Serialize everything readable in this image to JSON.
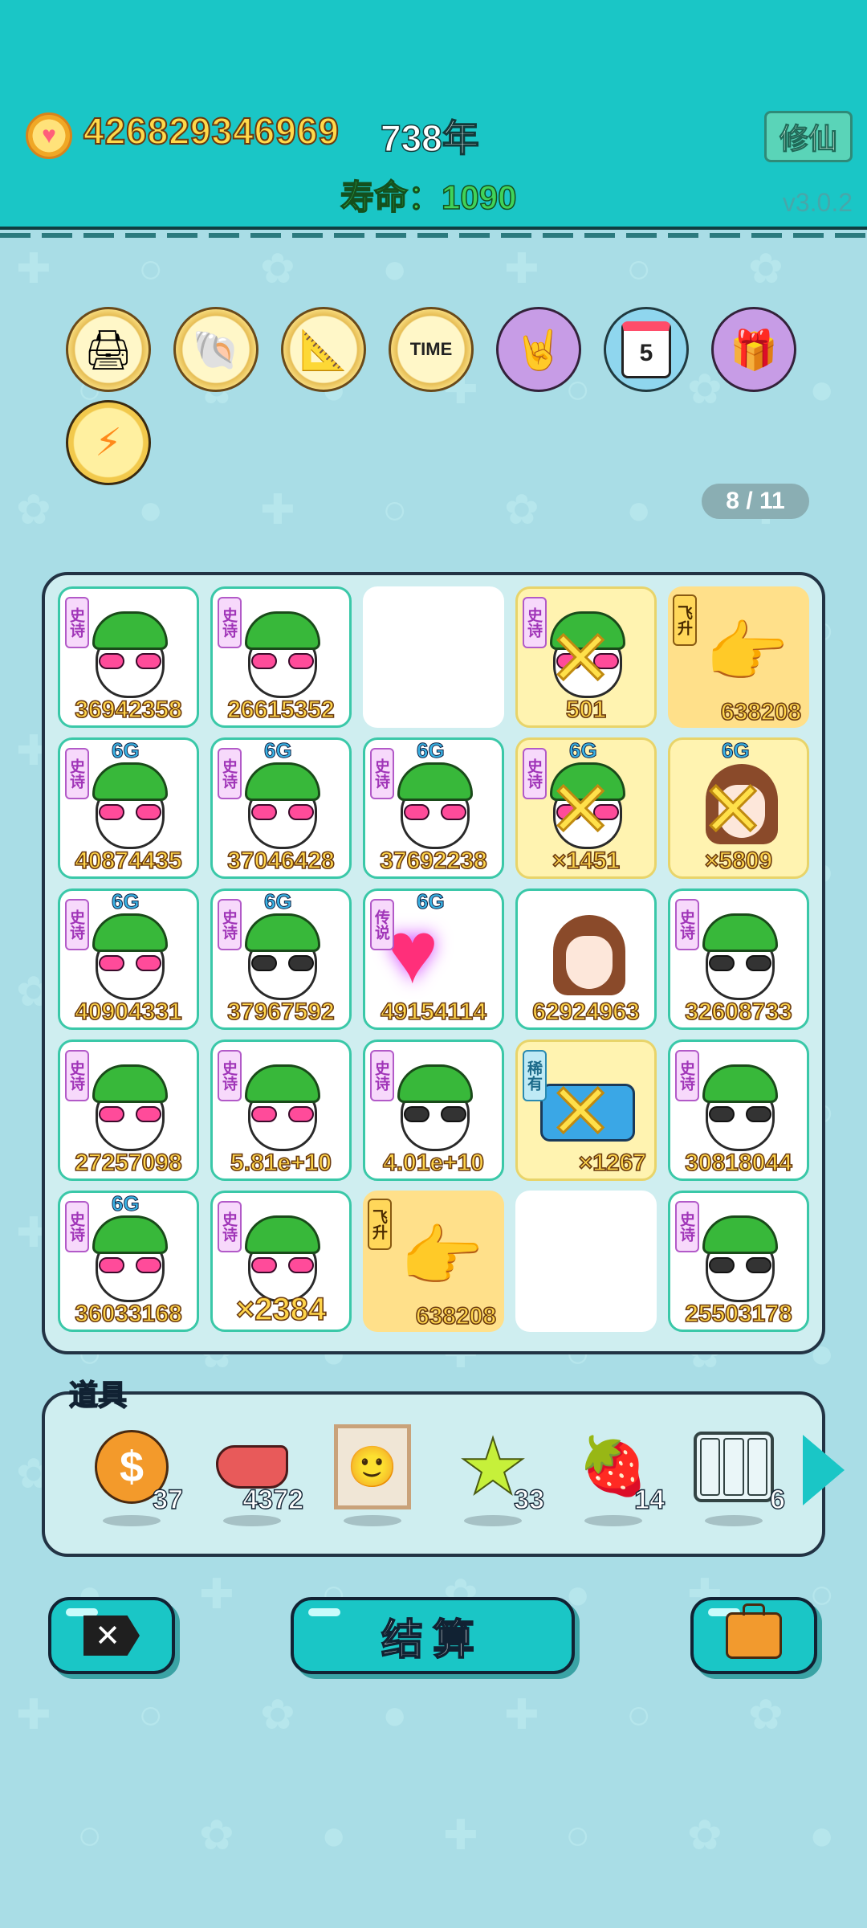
{
  "header": {
    "coins": "426829346969",
    "year": "738年",
    "life": "寿命：1090",
    "cultivate_label": "修仙",
    "version": "v3.0.2"
  },
  "relics": [
    {
      "name": "printer-icon"
    },
    {
      "name": "shell-icon"
    },
    {
      "name": "math-book-icon"
    },
    {
      "name": "time-magazine-icon"
    },
    {
      "name": "rock-hand-icon"
    },
    {
      "name": "calendar-icon"
    },
    {
      "name": "gift-box-icon"
    },
    {
      "name": "lightning-icon"
    }
  ],
  "relic_calendar_day": "5",
  "relic_magazine_text": "TIME",
  "page_indicator": "8 / 11",
  "board": {
    "cells": [
      {
        "tag": "史诗",
        "value": "36942358"
      },
      {
        "tag": "史诗",
        "value": "26615352"
      },
      {
        "value": ""
      },
      {
        "tag": "史诗",
        "value": "501"
      },
      {
        "tag": "飞升",
        "value": "638208"
      },
      {
        "tag": "史诗",
        "badge": "6G",
        "value": "40874435"
      },
      {
        "tag": "史诗",
        "badge": "6G",
        "value": "37046428"
      },
      {
        "tag": "史诗",
        "badge": "6G",
        "value": "37692238"
      },
      {
        "tag": "史诗",
        "badge": "6G",
        "value": "×1451"
      },
      {
        "badge": "6G",
        "value": "×5809"
      },
      {
        "tag": "史诗",
        "badge": "6G",
        "value": "40904331"
      },
      {
        "tag": "史诗",
        "badge": "6G",
        "value": "37967592"
      },
      {
        "tag": "传说",
        "badge": "6G",
        "value": "49154114"
      },
      {
        "value": "62924963"
      },
      {
        "tag": "史诗",
        "value": "32608733"
      },
      {
        "tag": "史诗",
        "value": "27257098"
      },
      {
        "tag": "史诗",
        "value": "5.81e+10"
      },
      {
        "tag": "史诗",
        "value": "4.01e+10"
      },
      {
        "tag": "稀有",
        "value": "×1267"
      },
      {
        "tag": "史诗",
        "value": "30818044"
      },
      {
        "tag": "史诗",
        "badge": "6G",
        "value": "36033168"
      },
      {
        "tag": "史诗",
        "value": "×2384"
      },
      {
        "tag": "飞升",
        "value": "638208"
      },
      {
        "value": ""
      },
      {
        "tag": "史诗",
        "value": "25503178"
      }
    ]
  },
  "items": {
    "label": "道具",
    "list": [
      {
        "icon": "coin-dollar-icon",
        "count": "37"
      },
      {
        "icon": "liver-icon",
        "count": "4372"
      },
      {
        "icon": "portrait-frame-icon",
        "count": ""
      },
      {
        "icon": "star-icon",
        "count": "33"
      },
      {
        "icon": "strawberry-icon",
        "count": "14"
      },
      {
        "icon": "shelf-icon",
        "count": "6"
      }
    ]
  },
  "buttons": {
    "exit_symbol": "✕",
    "settle_label": "结算"
  },
  "colors": {
    "teal": "#1ac6c6",
    "background": "#a9dde6",
    "gold_text": "#ffd54a",
    "cell_border": "#3ac8a8"
  }
}
